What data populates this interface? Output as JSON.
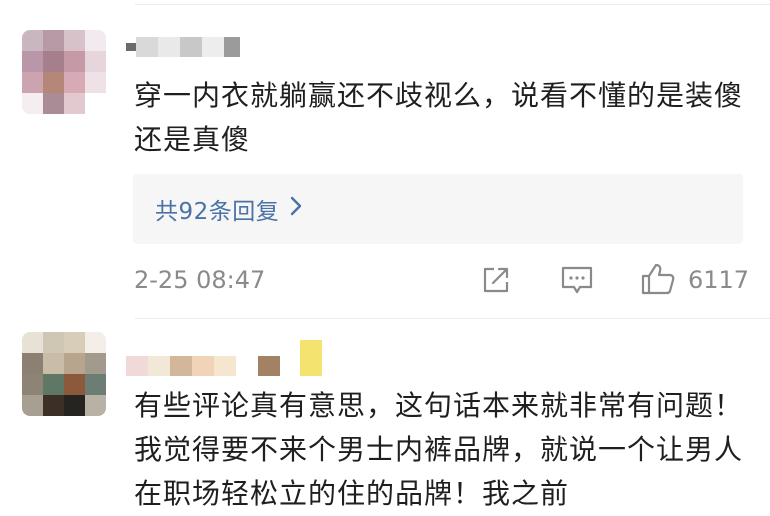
{
  "comments": [
    {
      "text": "穿一内衣就躺赢还不歧视么，说看不懂的是装傻还是真傻",
      "replies_label": "共92条回复",
      "timestamp": "2-25 08:47",
      "likes": "6117"
    },
    {
      "text": "有些评论真有意思，这句话本来就非常有问题！我觉得要不来个男士内裤品牌，就说一个让男人在职场轻松立的住的品牌！我之前"
    }
  ],
  "colors": {
    "link": "#4a72a6",
    "meta": "#8a8a8a",
    "reply_bg": "#f6f6f6"
  },
  "icons": [
    "chevron-right-icon",
    "share-icon",
    "comment-icon",
    "thumbs-up-icon"
  ]
}
